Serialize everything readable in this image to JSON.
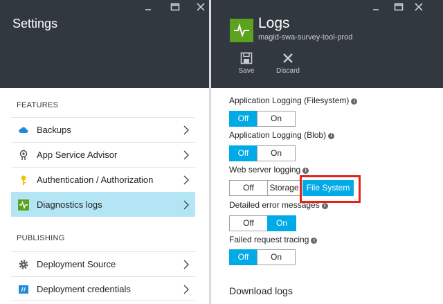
{
  "settings": {
    "title": "Settings",
    "sections": [
      {
        "heading": "FEATURES",
        "items": [
          {
            "label": "Backups",
            "icon": "cloud-backup-icon"
          },
          {
            "label": "App Service Advisor",
            "icon": "advisor-icon"
          },
          {
            "label": "Authentication / Authorization",
            "icon": "key-icon"
          },
          {
            "label": "Diagnostics logs",
            "icon": "diagnostics-icon",
            "active": true
          }
        ]
      },
      {
        "heading": "PUBLISHING",
        "items": [
          {
            "label": "Deployment Source",
            "icon": "gear-icon"
          },
          {
            "label": "Deployment credentials",
            "icon": "credentials-icon"
          }
        ]
      }
    ]
  },
  "logs": {
    "title": "Logs",
    "subtitle": "magid-swa-survey-tool-prod",
    "commands": {
      "save": "Save",
      "discard": "Discard"
    },
    "fields": [
      {
        "label": "Application Logging (Filesystem)",
        "options": [
          "Off",
          "On"
        ],
        "selected": "Off"
      },
      {
        "label": "Application Logging (Blob)",
        "options": [
          "Off",
          "On"
        ],
        "selected": "Off"
      },
      {
        "label": "Web server logging",
        "options": [
          "Off",
          "Storage",
          "File System"
        ],
        "selected": "File System"
      },
      {
        "label": "Detailed error messages",
        "options": [
          "Off",
          "On"
        ],
        "selected": "On"
      },
      {
        "label": "Failed request tracing",
        "options": [
          "Off",
          "On"
        ],
        "selected": "Off"
      }
    ],
    "download_heading": "Download logs"
  },
  "colors": {
    "header_bg": "#32383f",
    "accent": "#00aae7",
    "active_row": "#b3e5f5",
    "app_icon": "#5ba31e",
    "highlight": "#e2231a"
  }
}
